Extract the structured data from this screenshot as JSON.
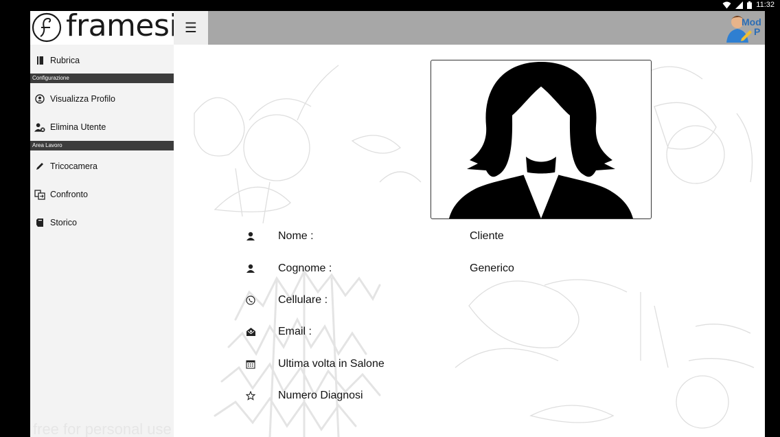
{
  "status_bar": {
    "time": "11:32"
  },
  "brand": {
    "name": "framesi"
  },
  "sidebar": {
    "rubrica": "Rubrica",
    "section_config": "Configurazione",
    "visualizza_profilo": "Visualizza Profilo",
    "elimina_utente": "Elimina Utente",
    "section_area": "Area Lavoro",
    "tricocamera": "Tricocamera",
    "confronto": "Confronto",
    "storico": "Storico"
  },
  "watermark": "free for personal use",
  "topbar": {
    "menu_icon": "hamburger-icon",
    "mod_text_1": "Mod",
    "mod_text_2": "P"
  },
  "profile": {
    "fields": [
      {
        "icon": "person-icon",
        "label": "Nome :",
        "value": "Cliente"
      },
      {
        "icon": "person-icon",
        "label": "Cognome :",
        "value": "Generico"
      },
      {
        "icon": "phone-icon",
        "label": "Cellulare :",
        "value": ""
      },
      {
        "icon": "mail-icon",
        "label": "Email :",
        "value": ""
      },
      {
        "icon": "calendar-icon",
        "label": "Ultima volta in Salone",
        "value": ""
      },
      {
        "icon": "star-icon",
        "label": "Numero Diagnosi",
        "value": ""
      }
    ]
  },
  "colors": {
    "topbar": "#a7a7a7",
    "sidebar": "#f3f3f3",
    "section_header": "#3c3c3c"
  }
}
